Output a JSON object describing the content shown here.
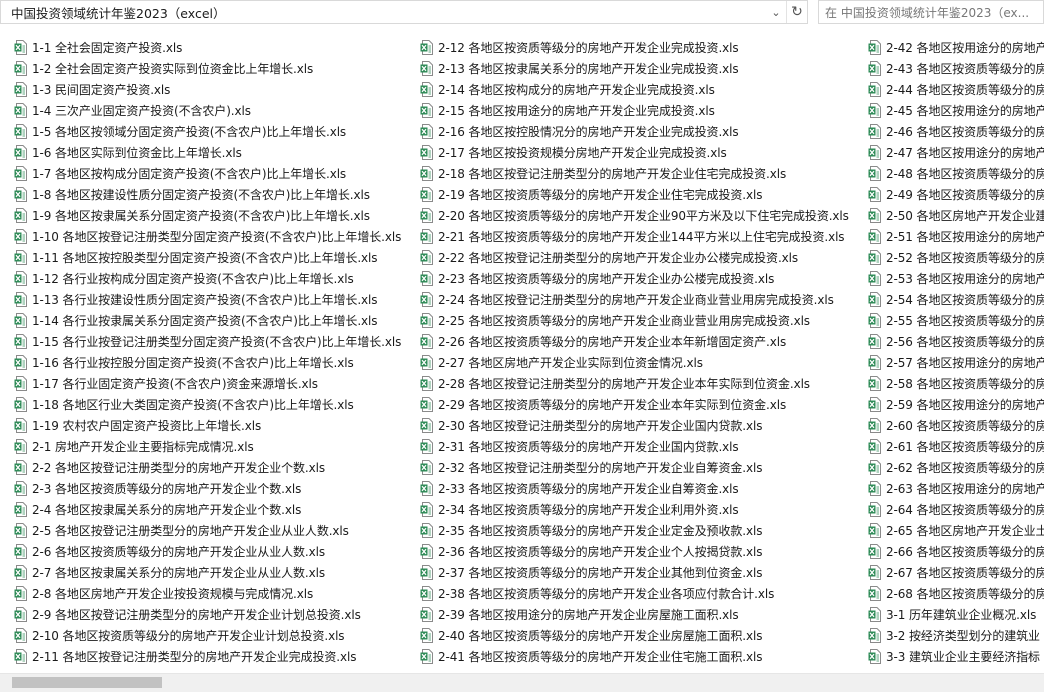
{
  "address_bar": {
    "path": "中国投资领域统计年鉴2023（excel）",
    "dropdown_icon": "chevron-down-icon",
    "refresh_icon": "refresh-icon"
  },
  "search": {
    "placeholder": "在 中国投资领域统计年鉴2023（ex..."
  },
  "icon_color": "#2e8b57",
  "columns": [
    {
      "files": [
        "1-1 全社会固定资产投资.xls",
        "1-2 全社会固定资产投资实际到位资金比上年增长.xls",
        "1-3 民间固定资产投资.xls",
        "1-4 三次产业固定资产投资(不含农户).xls",
        "1-5 各地区按领域分固定资产投资(不含农户)比上年增长.xls",
        "1-6 各地区实际到位资金比上年增长.xls",
        "1-7 各地区按构成分固定资产投资(不含农户)比上年增长.xls",
        "1-8 各地区按建设性质分固定资产投资(不含农户)比上年增长.xls",
        "1-9 各地区按隶属关系分固定资产投资(不含农户)比上年增长.xls",
        "1-10 各地区按登记注册类型分固定资产投资(不含农户)比上年增长.xls",
        "1-11 各地区按控股类型分固定资产投资(不含农户)比上年增长.xls",
        "1-12 各行业按构成分固定资产投资(不含农户)比上年增长.xls",
        "1-13 各行业按建设性质分固定资产投资(不含农户)比上年增长.xls",
        "1-14 各行业按隶属关系分固定资产投资(不含农户)比上年增长.xls",
        "1-15 各行业按登记注册类型分固定资产投资(不含农户)比上年增长.xls",
        "1-16 各行业按控股分固定资产投资(不含农户)比上年增长.xls",
        "1-17 各行业固定资产投资(不含农户)资金来源增长.xls",
        "1-18 各地区行业大类固定资产投资(不含农户)比上年增长.xls",
        "1-19 农村农户固定资产投资比上年增长.xls",
        "2-1 房地产开发企业主要指标完成情况.xls",
        "2-2 各地区按登记注册类型分的房地产开发企业个数.xls",
        "2-3 各地区按资质等级分的房地产开发企业个数.xls",
        "2-4 各地区按隶属关系分的房地产开发企业个数.xls",
        "2-5 各地区按登记注册类型分的房地产开发企业从业人数.xls",
        "2-6 各地区按资质等级分的房地产开发企业从业人数.xls",
        "2-7 各地区按隶属关系分的房地产开发企业从业人数.xls",
        "2-8 各地区房地产开发企业按投资规模与完成情况.xls",
        "2-9 各地区按登记注册类型分的房地产开发企业计划总投资.xls",
        "2-10 各地区按资质等级分的房地产开发企业计划总投资.xls",
        "2-11 各地区按登记注册类型分的房地产开发企业完成投资.xls"
      ]
    },
    {
      "files": [
        "2-12 各地区按资质等级分的房地产开发企业完成投资.xls",
        "2-13 各地区按隶属关系分的房地产开发企业完成投资.xls",
        "2-14 各地区按构成分的房地产开发企业完成投资.xls",
        "2-15 各地区按用途分的房地产开发企业完成投资.xls",
        "2-16 各地区按控股情况分的房地产开发企业完成投资.xls",
        "2-17 各地区按投资规模分房地产开发企业完成投资.xls",
        "2-18 各地区按登记注册类型分的房地产开发企业住宅完成投资.xls",
        "2-19 各地区按资质等级分的房地产开发企业住宅完成投资.xls",
        "2-20 各地区按资质等级分的房地产开发企业90平方米及以下住宅完成投资.xls",
        "2-21 各地区按资质等级分的房地产开发企业144平方米以上住宅完成投资.xls",
        "2-22 各地区按登记注册类型分的房地产开发企业办公楼完成投资.xls",
        "2-23 各地区按资质等级分的房地产开发企业办公楼完成投资.xls",
        "2-24 各地区按登记注册类型分的房地产开发企业商业营业用房完成投资.xls",
        "2-25 各地区按资质等级分的房地产开发企业商业营业用房完成投资.xls",
        "2-26 各地区按资质等级分的房地产开发企业本年新增固定资产.xls",
        "2-27 各地区房地产开发企业实际到位资金情况.xls",
        "2-28 各地区按登记注册类型分的房地产开发企业本年实际到位资金.xls",
        "2-29 各地区按资质等级分的房地产开发企业本年实际到位资金.xls",
        "2-30 各地区按登记注册类型分的房地产开发企业国内贷款.xls",
        "2-31 各地区按资质等级分的房地产开发企业国内贷款.xls",
        "2-32 各地区按登记注册类型分的房地产开发企业自筹资金.xls",
        "2-33 各地区按资质等级分的房地产开发企业自筹资金.xls",
        "2-34 各地区按资质等级分的房地产开发企业利用外资.xls",
        "2-35 各地区按资质等级分的房地产开发企业定金及预收款.xls",
        "2-36 各地区按资质等级分的房地产开发企业个人按揭贷款.xls",
        "2-37 各地区按资质等级分的房地产开发企业其他到位资金.xls",
        "2-38 各地区按资质等级分的房地产开发企业各项应付款合计.xls",
        "2-39 各地区按用途分的房地产开发企业房屋施工面积.xls",
        "2-40 各地区按资质等级分的房地产开发企业房屋施工面积.xls",
        "2-41 各地区按资质等级分的房地产开发企业住宅施工面积.xls"
      ]
    },
    {
      "files": [
        "2-42 各地区按用途分的房地产",
        "2-43 各地区按资质等级分的房",
        "2-44 各地区按资质等级分的房",
        "2-45 各地区按用途分的房地产",
        "2-46 各地区按资质等级分的房",
        "2-47 各地区按用途分的房地产",
        "2-48 各地区按资质等级分的房",
        "2-49 各地区按资质等级分的房",
        "2-50 各地区房地产开发企业建",
        "2-51 各地区按用途分的房地产",
        "2-52 各地区按资质等级分的房",
        "2-53 各地区按用途分的房地产",
        "2-54 各地区按资质等级分的房",
        "2-55 各地区按资质等级分的房",
        "2-56 各地区按资质等级分的房",
        "2-57 各地区按用途分的房地产",
        "2-58 各地区按资质等级分的房",
        "2-59 各地区按用途分的房地产",
        "2-60 各地区按资质等级分的房",
        "2-61 各地区按资质等级分的房",
        "2-62 各地区按资质等级分的房",
        "2-63 各地区按用途分的房地产",
        "2-64 各地区按资质等级分的房",
        "2-65 各地区房地产开发企业土",
        "2-66 各地区按资质等级分的房",
        "2-67 各地区按资质等级分的房",
        "2-68 各地区按资质等级分的房",
        "3-1 历年建筑业企业概况.xls",
        "3-2 按经济类型划分的建筑业",
        "3-3 建筑业企业主要经济指标"
      ]
    }
  ]
}
